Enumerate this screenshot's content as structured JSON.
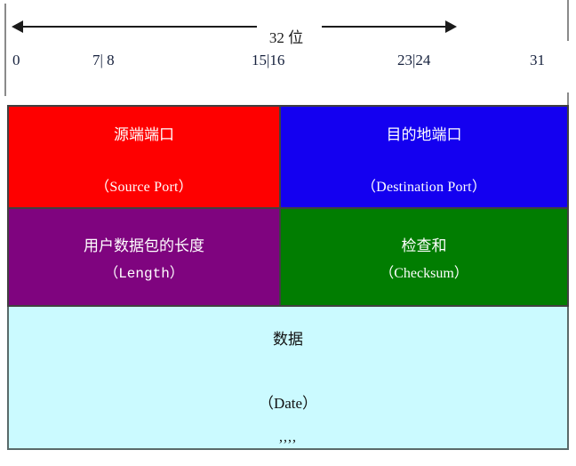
{
  "ruler": {
    "width_label": "32 位",
    "bit_ticks": [
      {
        "name": "bit-0",
        "label": "0"
      },
      {
        "name": "bit-7-8",
        "label": "7| 8"
      },
      {
        "name": "bit-15-16",
        "label": "15|16"
      },
      {
        "name": "bit-23-24",
        "label": "23|24"
      },
      {
        "name": "bit-31",
        "label": "31"
      }
    ]
  },
  "packet": {
    "rows": [
      {
        "fields": [
          {
            "cn": "源端端口",
            "en": "（Source      Port）",
            "color": "#fe0000"
          },
          {
            "cn": "目的地端口",
            "en": "（Destination      Port）",
            "color": "#1400f0"
          }
        ]
      },
      {
        "fields": [
          {
            "cn": "用户数据包的长度",
            "en": "（Length）",
            "color": "#7f047f"
          },
          {
            "cn": "检查和",
            "en": "（Checksum）",
            "color": "#017d01"
          }
        ]
      },
      {
        "fields": [
          {
            "cn": "数据",
            "en": "（Date）",
            "marks": ",,,,",
            "color": "#cbfaff"
          }
        ]
      }
    ]
  },
  "colors": {
    "source_port": "#fe0000",
    "destination_port": "#1400f0",
    "length": "#7f047f",
    "checksum": "#017d01",
    "data": "#cbfaff",
    "arrow": "#1b1b1b",
    "border": "#404040",
    "guide": "#8a8a8a"
  }
}
